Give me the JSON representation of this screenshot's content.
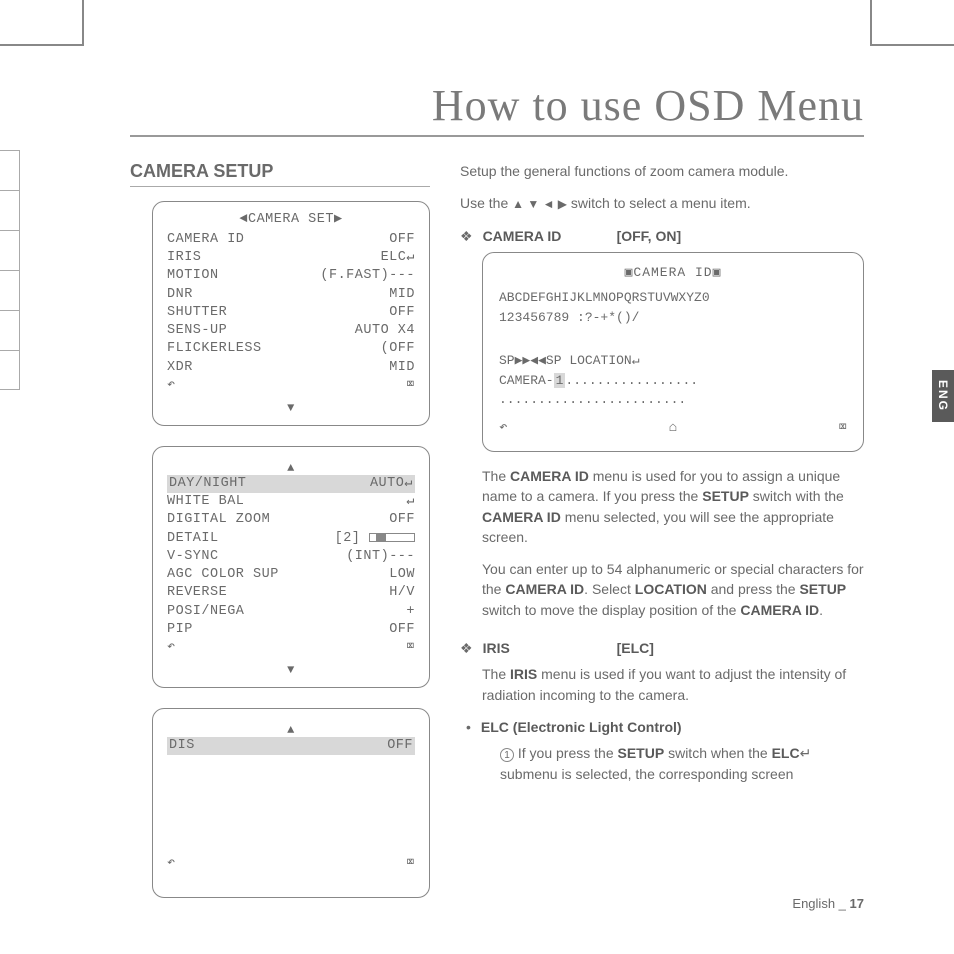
{
  "title": "How to use OSD Menu",
  "section": "CAMERA SETUP",
  "lang_tab": "ENG",
  "footer": {
    "lang": "English",
    "sep": "_",
    "page": "17"
  },
  "osd1": {
    "header": "◄CAMERA SET▶",
    "rows": [
      {
        "l": "CAMERA ID",
        "r": "OFF"
      },
      {
        "l": "IRIS",
        "r": "ELC↵"
      },
      {
        "l": "MOTION",
        "r": "(F.FAST)---"
      },
      {
        "l": "DNR",
        "r": "MID"
      },
      {
        "l": "SHUTTER",
        "r": "OFF"
      },
      {
        "l": "SENS-UP",
        "r": "AUTO X4"
      },
      {
        "l": "FLICKERLESS",
        "r": "(OFF"
      },
      {
        "l": "XDR",
        "r": "MID"
      },
      {
        "l": "↶",
        "r": "⌧"
      }
    ],
    "down": "▼"
  },
  "osd2": {
    "up": "▲",
    "rows": [
      {
        "l": "DAY/NIGHT",
        "r": "AUTO↵",
        "hl": true
      },
      {
        "l": "WHITE BAL",
        "r": "↵"
      },
      {
        "l": "DIGITAL ZOOM",
        "r": "OFF"
      },
      {
        "l": "DETAIL",
        "r": "[2]",
        "slider": true
      },
      {
        "l": "V-SYNC",
        "r": "(INT)---"
      },
      {
        "l": "AGC COLOR SUP",
        "r": "LOW"
      },
      {
        "l": "REVERSE",
        "r": "H/V"
      },
      {
        "l": "POSI/NEGA",
        "r": "+"
      },
      {
        "l": "PIP",
        "r": "OFF"
      },
      {
        "l": "↶",
        "r": "⌧"
      }
    ],
    "down": "▼"
  },
  "osd3": {
    "up": "▲",
    "rows": [
      {
        "l": "DIS",
        "r": "OFF",
        "hl": true
      }
    ],
    "spacer": 7,
    "foot": {
      "l": "↶",
      "r": "⌧"
    }
  },
  "intro1": "Setup the general functions of zoom camera module.",
  "intro2a": "Use the ",
  "intro2arrows": "▲ ▼ ◄ ▶",
  "intro2b": " switch to select a menu item.",
  "item_camid": {
    "bullet": "❖",
    "name": "CAMERA ID",
    "opts": "[OFF, ON]"
  },
  "camid_box": {
    "header": "▣CAMERA ID▣",
    "line1": "ABCDEFGHIJKLMNOPQRSTUVWXYZ0",
    "line2": "123456789 :?-+*()/",
    "line3": "SP▶▶◀◀SP LOCATION↵",
    "line4a": "CAMERA-",
    "line4hl": "1",
    "line4b": ".................",
    "line5": "........................",
    "foot": {
      "l": "↶",
      "m": "⌂",
      "r": "⌧"
    }
  },
  "camid_p1a": "The ",
  "camid_p1b": "CAMERA ID",
  "camid_p1c": " menu is used for you to assign a unique name to a camera. If you press the ",
  "camid_p1d": "SETUP",
  "camid_p1e": " switch with the ",
  "camid_p1f": "CAMERA ID",
  "camid_p1g": " menu selected, you will see the appropriate screen.",
  "camid_p2a": "You can enter up to 54 alphanumeric or special characters for the ",
  "camid_p2b": "CAMERA ID",
  "camid_p2c": ". Select ",
  "camid_p2d": "LOCATION",
  "camid_p2e": " and press the ",
  "camid_p2f": "SETUP",
  "camid_p2g": " switch to move the display position of the ",
  "camid_p2h": "CAMERA ID",
  "camid_p2i": ".",
  "item_iris": {
    "bullet": "❖",
    "name": "IRIS",
    "opts": "[ELC]"
  },
  "iris_p1a": "The ",
  "iris_p1b": "IRIS",
  "iris_p1c": " menu is used if you want to adjust the intensity of radiation incoming to the camera.",
  "elc_head": {
    "bullet": "•",
    "text": "ELC (Electronic Light Control)"
  },
  "elc_num": "1",
  "elc_p1a": "If you press the ",
  "elc_p1b": "SETUP",
  "elc_p1c": " switch when the ",
  "elc_p1d": "ELC",
  "elc_p1e": "↵ submenu is selected, the corresponding screen"
}
